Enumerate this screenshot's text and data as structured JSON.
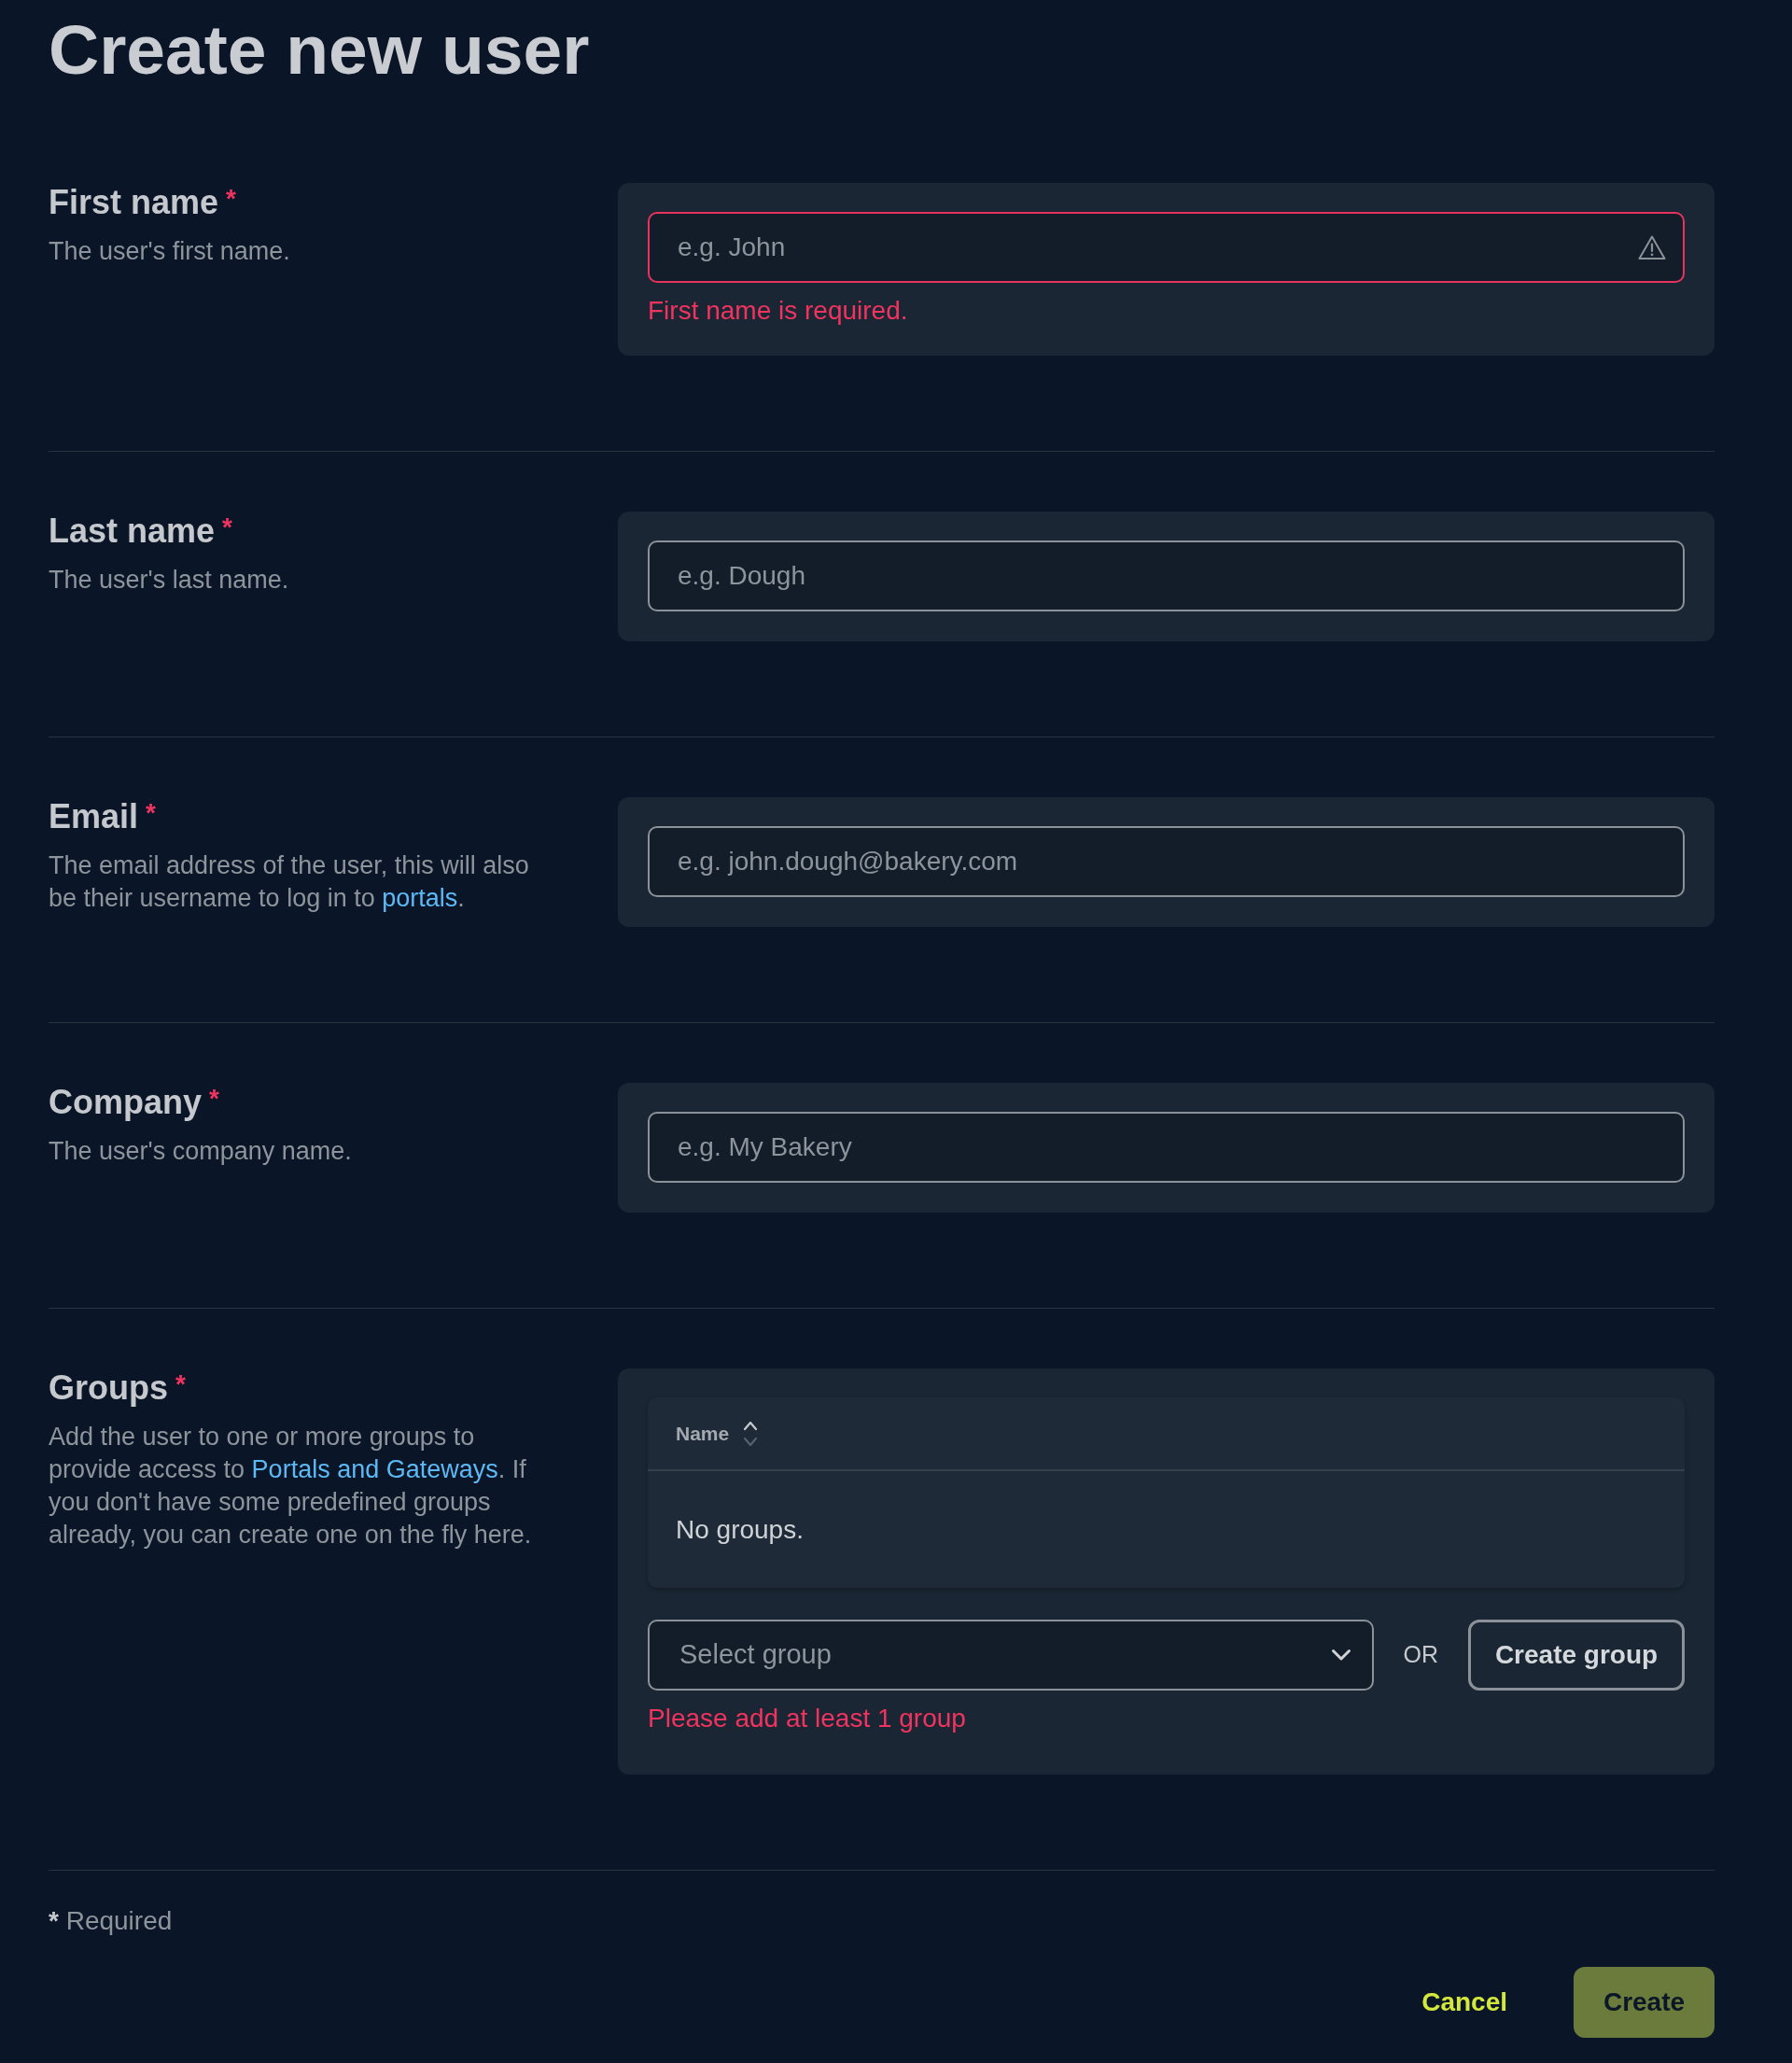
{
  "title": "Create new user",
  "fields": [
    {
      "kind": "text",
      "label": "First name",
      "required_mark": "*",
      "description": [
        {
          "kind": "text",
          "text": "The user's first name."
        }
      ],
      "placeholder": "e.g. John",
      "invalid": true,
      "error": "First name is required."
    },
    {
      "kind": "text",
      "label": "Last name",
      "required_mark": "*",
      "description": [
        {
          "kind": "text",
          "text": "The user's last name."
        }
      ],
      "placeholder": "e.g. Dough",
      "invalid": false
    },
    {
      "kind": "text",
      "label": "Email",
      "required_mark": "*",
      "description": [
        {
          "kind": "text",
          "text": "The email address of the user, this will also be their username to log in to "
        },
        {
          "kind": "link",
          "text": "portals"
        },
        {
          "kind": "text",
          "text": "."
        }
      ],
      "placeholder": "e.g. john.dough@bakery.com",
      "invalid": false
    },
    {
      "kind": "text",
      "label": "Company",
      "required_mark": "*",
      "description": [
        {
          "kind": "text",
          "text": "The user's company name."
        }
      ],
      "placeholder": "e.g. My Bakery",
      "invalid": false
    },
    {
      "kind": "groups",
      "label": "Groups",
      "required_mark": "*",
      "description": [
        {
          "kind": "text",
          "text": "Add the user to one or more groups to provide access to "
        },
        {
          "kind": "link",
          "text": "Portals and Gateways"
        },
        {
          "kind": "text",
          "text": ". If you don't have some predefined groups already, you can create one on the fly here."
        }
      ],
      "table": {
        "columns": [
          {
            "label": "Name",
            "sortable": true
          }
        ],
        "empty_text": "No groups."
      },
      "select": {
        "placeholder": "Select group",
        "invalid": false
      },
      "or_text": "OR",
      "create_button": "Create group",
      "error": "Please add at least 1 group"
    }
  ],
  "footer": {
    "required_note": {
      "mark": "*",
      "text": "Required"
    },
    "actions": [
      {
        "kind": "link",
        "label": "Cancel"
      },
      {
        "kind": "primary",
        "label": "Create"
      }
    ]
  }
}
